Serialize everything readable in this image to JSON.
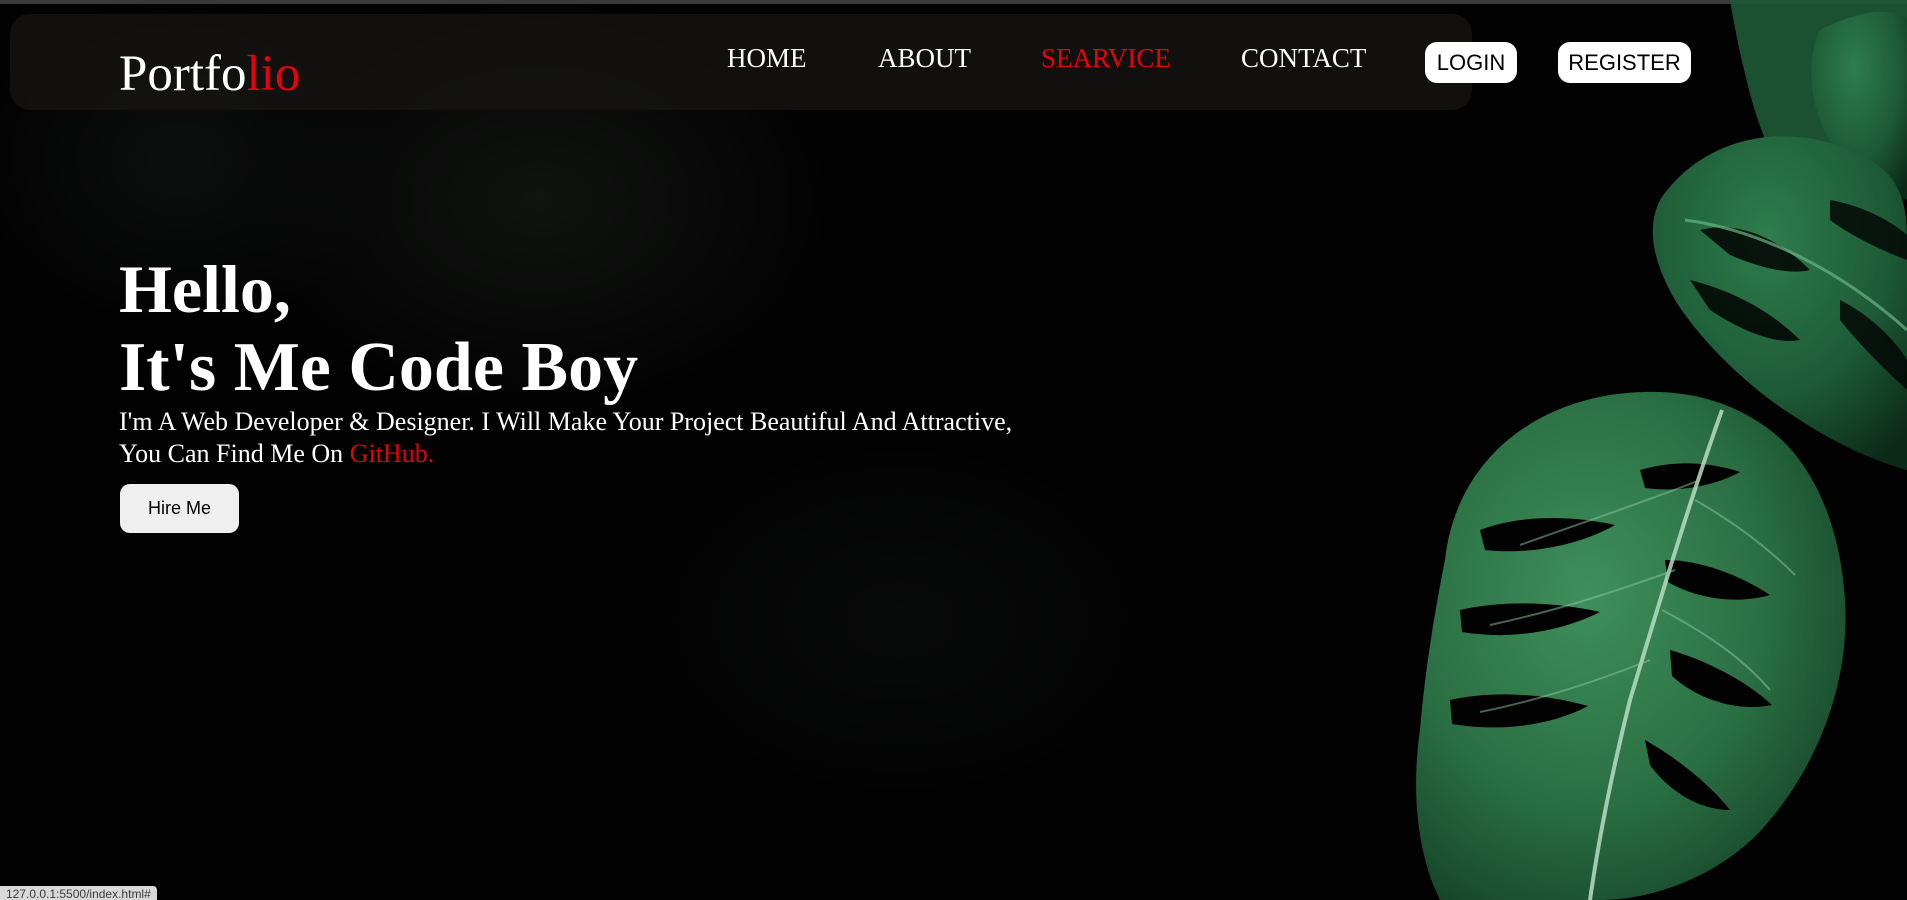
{
  "nav": {
    "logo_main": "Portfo",
    "logo_accent": "lio",
    "links": [
      {
        "label": "HOME",
        "active": false
      },
      {
        "label": "ABOUT",
        "active": false
      },
      {
        "label": "SEARVICE",
        "active": true
      },
      {
        "label": "CONTACT",
        "active": false
      }
    ],
    "login_label": "LOGIN",
    "register_label": "REGISTER"
  },
  "hero": {
    "greeting": "Hello,",
    "headline": "It's Me Code Boy",
    "description_line1": "I'm A Web Developer & Designer. I Will Make Your Project Beautiful And Attractive,",
    "description_line2": "You Can Find Me On ",
    "github_label": "GitHub.",
    "hire_label": "Hire Me"
  },
  "status_bar": {
    "url": "127.0.0.1:5500/index.html#"
  },
  "colors": {
    "accent": "#e8000c",
    "background": "#020202",
    "navbar": "#161513",
    "leaf": "#2f7a4a"
  }
}
